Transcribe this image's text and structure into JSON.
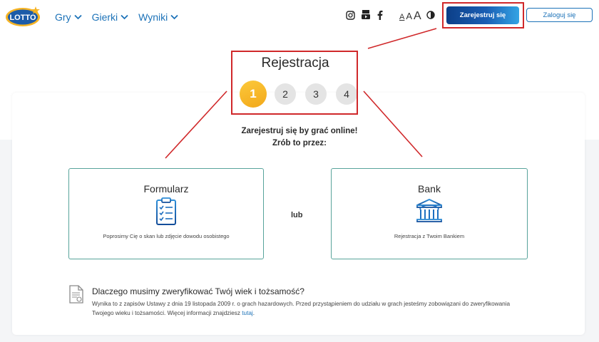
{
  "header": {
    "logo_text": "LOTTO",
    "nav": [
      {
        "label": "Gry"
      },
      {
        "label": "Gierki"
      },
      {
        "label": "Wyniki"
      }
    ],
    "social_icons": [
      "instagram-icon",
      "youtube-icon",
      "facebook-icon"
    ],
    "font_size_labels": [
      "A",
      "A",
      "A"
    ],
    "register_label": "Zarejestruj się",
    "login_label": "Zaloguj się"
  },
  "registration": {
    "title": "Rejestracja",
    "steps": [
      "1",
      "2",
      "3",
      "4"
    ],
    "active_step": 1,
    "lead_line1": "Zarejestruj się by grać online!",
    "lead_line2": "Zrób to przez:"
  },
  "options": {
    "form": {
      "title": "Formularz",
      "icon": "clipboard-checklist-icon",
      "description": "Poprosimy Cię o skan lub zdjęcie dowodu osobistego"
    },
    "or_label": "lub",
    "bank": {
      "title": "Bank",
      "icon": "bank-building-icon",
      "description": "Rejestracja z Twoim Bankiem"
    }
  },
  "info": {
    "title": "Dlaczego musimy zweryfikować Twój wiek i tożsamość?",
    "text": "Wynika to z zapisów Ustawy z dnia 19 listopada 2009 r. o grach hazardowych. Przed przystąpieniem do udziału w grach jesteśmy zobowiązani do zweryfikowania Twojego wieku i tożsamości. Więcej informacji znajdziesz ",
    "link_label": "tutaj",
    "text_end": "."
  },
  "colors": {
    "brand_blue": "#1c72b8",
    "annotation_red": "#d0282a",
    "active_step": "#f5b324",
    "card_border": "#58a39b"
  }
}
